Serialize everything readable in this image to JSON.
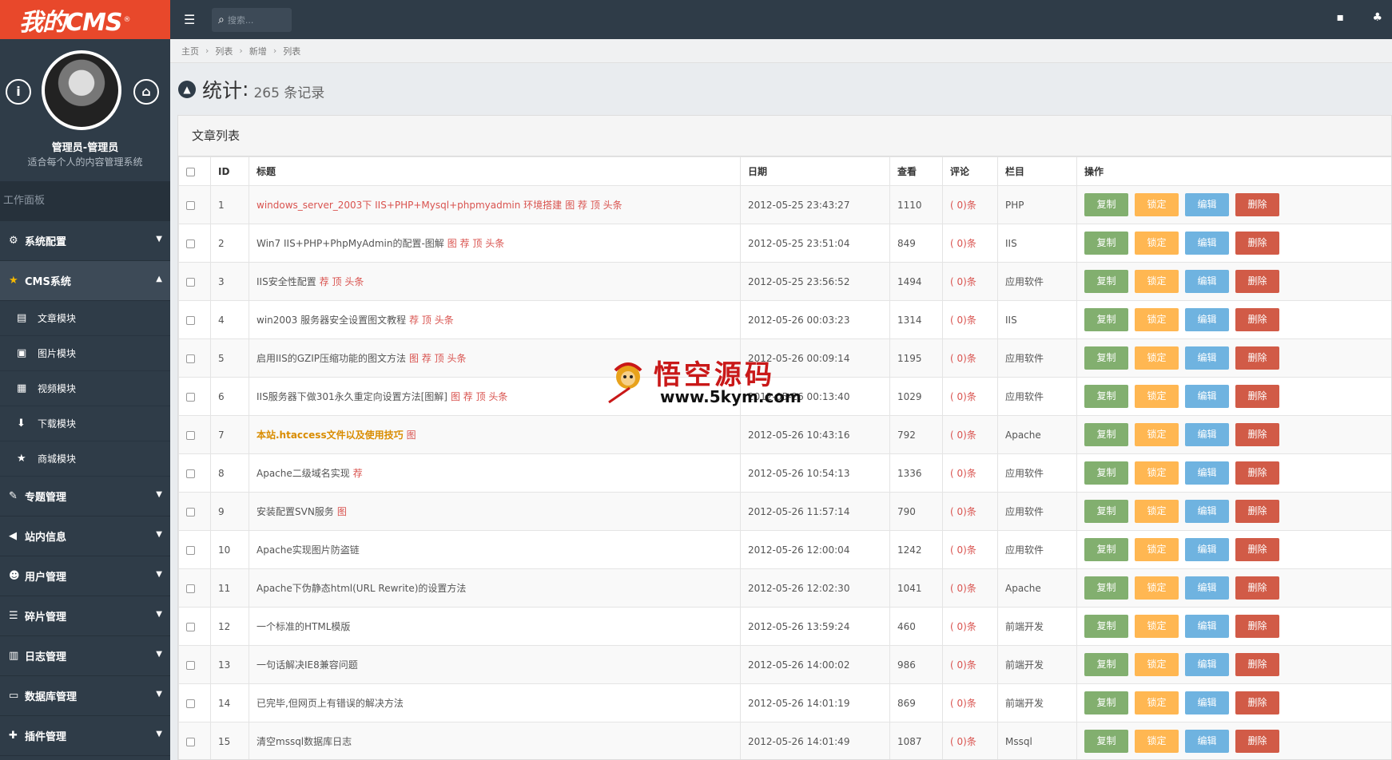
{
  "logo": "我的CMS",
  "profile": {
    "name": "管理员-管理员",
    "desc": "适合每个人的内容管理系统"
  },
  "sidebar": {
    "workbench": "工作面板",
    "menus": [
      {
        "label": "系统配置",
        "icon": "cogs-icon",
        "glyph": "⚙"
      },
      {
        "label": "CMS系统",
        "icon": "star-icon",
        "glyph": "★",
        "active": true,
        "subs": [
          {
            "label": "文章模块",
            "icon": "file-icon",
            "glyph": "▤"
          },
          {
            "label": "图片模块",
            "icon": "image-icon",
            "glyph": "▣"
          },
          {
            "label": "视频模块",
            "icon": "film-icon",
            "glyph": "▦"
          },
          {
            "label": "下载模块",
            "icon": "download-icon",
            "glyph": "⬇"
          },
          {
            "label": "商城模块",
            "icon": "star-icon",
            "glyph": "★"
          }
        ]
      },
      {
        "label": "专题管理",
        "icon": "pencil-icon",
        "glyph": "✎"
      },
      {
        "label": "站内信息",
        "icon": "bullhorn-icon",
        "glyph": "◀"
      },
      {
        "label": "用户管理",
        "icon": "users-icon",
        "glyph": "☻"
      },
      {
        "label": "碎片管理",
        "icon": "list-icon",
        "glyph": "☰"
      },
      {
        "label": "日志管理",
        "icon": "book-icon",
        "glyph": "▥"
      },
      {
        "label": "数据库管理",
        "icon": "hdd-icon",
        "glyph": "▭"
      },
      {
        "label": "插件管理",
        "icon": "puzzle-icon",
        "glyph": "✚"
      }
    ]
  },
  "topbar": {
    "search_placeholder": "搜索..."
  },
  "breadcrumb": [
    "主页",
    "列表",
    "新增",
    "列表"
  ],
  "page": {
    "title": "统计",
    "count": "265 条记录"
  },
  "panel": {
    "title": "文章列表"
  },
  "table": {
    "headers": [
      "ID",
      "标题",
      "日期",
      "查看",
      "评论",
      "栏目",
      "操作"
    ],
    "buttons": {
      "copy": "复制",
      "lock": "锁定",
      "edit": "编辑",
      "delete": "删除"
    },
    "comment": "( 0)条",
    "rows": [
      {
        "id": "1",
        "title": "windows_server_2003下 IIS+PHP+Mysql+phpmyadmin 环境搭建",
        "style": "red",
        "tags": "图 荐 顶 头条",
        "date": "2012-05-25 23:43:27",
        "views": "1110",
        "cat": "PHP"
      },
      {
        "id": "2",
        "title": "Win7 IIS+PHP+PhpMyAdmin的配置-图解",
        "style": "",
        "tags": "图 荐 顶 头条",
        "date": "2012-05-25 23:51:04",
        "views": "849",
        "cat": "IIS"
      },
      {
        "id": "3",
        "title": "IIS安全性配置",
        "style": "",
        "tags": "荐 顶 头条",
        "date": "2012-05-25 23:56:52",
        "views": "1494",
        "cat": "应用软件"
      },
      {
        "id": "4",
        "title": "win2003 服务器安全设置图文教程",
        "style": "",
        "tags": "荐 顶 头条",
        "date": "2012-05-26 00:03:23",
        "views": "1314",
        "cat": "IIS"
      },
      {
        "id": "5",
        "title": "启用IIS的GZIP压缩功能的图文方法",
        "style": "",
        "tags": "图 荐 顶 头条",
        "date": "2012-05-26 00:09:14",
        "views": "1195",
        "cat": "应用软件"
      },
      {
        "id": "6",
        "title": "IIS服务器下做301永久重定向设置方法[图解]",
        "style": "",
        "tags": "图 荐 顶 头条",
        "date": "2012-05-26 00:13:40",
        "views": "1029",
        "cat": "应用软件"
      },
      {
        "id": "7",
        "title": "本站.htaccess文件以及使用技巧",
        "style": "orange",
        "tags": "图",
        "date": "2012-05-26 10:43:16",
        "views": "792",
        "cat": "Apache"
      },
      {
        "id": "8",
        "title": "Apache二级域名实现",
        "style": "",
        "tags": "荐",
        "date": "2012-05-26 10:54:13",
        "views": "1336",
        "cat": "应用软件"
      },
      {
        "id": "9",
        "title": "安装配置SVN服务",
        "style": "",
        "tags": "图",
        "date": "2012-05-26 11:57:14",
        "views": "790",
        "cat": "应用软件"
      },
      {
        "id": "10",
        "title": "Apache实现图片防盗链",
        "style": "",
        "tags": "",
        "date": "2012-05-26 12:00:04",
        "views": "1242",
        "cat": "应用软件"
      },
      {
        "id": "11",
        "title": "Apache下伪静态html(URL Rewrite)的设置方法",
        "style": "",
        "tags": "",
        "date": "2012-05-26 12:02:30",
        "views": "1041",
        "cat": "Apache"
      },
      {
        "id": "12",
        "title": "一个标准的HTML模版",
        "style": "",
        "tags": "",
        "date": "2012-05-26 13:59:24",
        "views": "460",
        "cat": "前端开发"
      },
      {
        "id": "13",
        "title": "一句话解决IE8兼容问题",
        "style": "",
        "tags": "",
        "date": "2012-05-26 14:00:02",
        "views": "986",
        "cat": "前端开发"
      },
      {
        "id": "14",
        "title": "已完毕,但网页上有错误的解决方法",
        "style": "",
        "tags": "",
        "date": "2012-05-26 14:01:19",
        "views": "869",
        "cat": "前端开发"
      },
      {
        "id": "15",
        "title": "清空mssql数据库日志",
        "style": "",
        "tags": "",
        "date": "2012-05-26 14:01:49",
        "views": "1087",
        "cat": "Mssql"
      }
    ]
  },
  "watermark": {
    "text": "悟空源码",
    "url": "www.5kym.com"
  }
}
